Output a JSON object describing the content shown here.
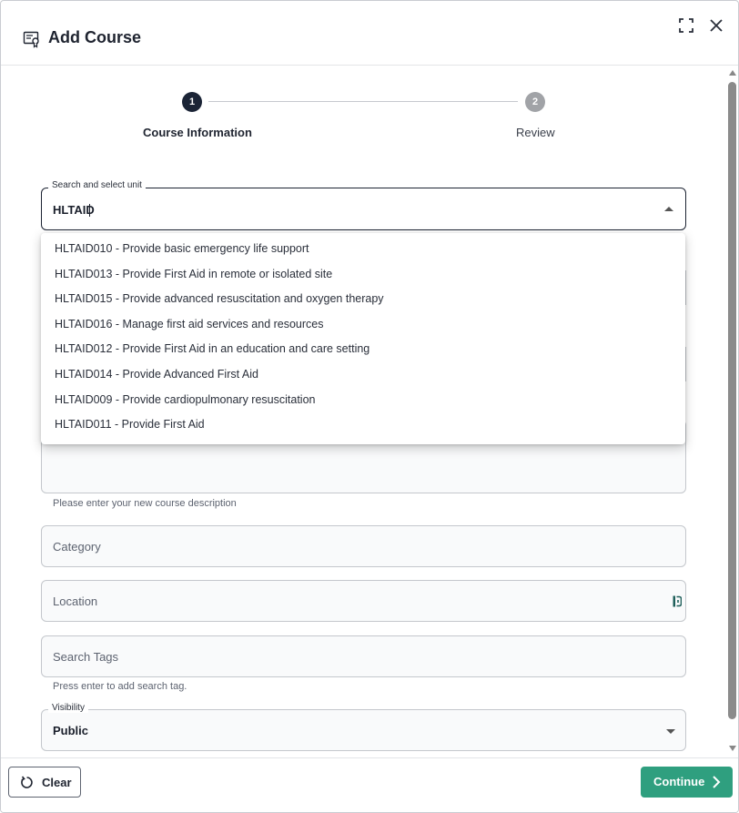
{
  "dialog": {
    "title": "Add Course"
  },
  "stepper": {
    "steps": [
      {
        "number": "1",
        "label": "Course Information"
      },
      {
        "number": "2",
        "label": "Review"
      }
    ]
  },
  "unit_search": {
    "label": "Search and select unit",
    "value": "HLTAID"
  },
  "unit_options": [
    "HLTAID010 - Provide basic emergency life support",
    "HLTAID013 - Provide First Aid in remote or isolated site",
    "HLTAID015 - Provide advanced resuscitation and oxygen therapy",
    "HLTAID016 - Manage first aid services and resources",
    "HLTAID012 - Provide First Aid in an education and care setting",
    "HLTAID014 - Provide Advanced First Aid",
    "HLTAID009 - Provide cardiopulmonary resuscitation",
    "HLTAID011 - Provide First Aid"
  ],
  "description": {
    "helper": "Please enter your new course description"
  },
  "category": {
    "placeholder": "Category"
  },
  "location": {
    "placeholder": "Location"
  },
  "tags": {
    "placeholder": "Search Tags",
    "helper": "Press enter to add search tag."
  },
  "visibility": {
    "label": "Visibility",
    "value": "Public"
  },
  "footer": {
    "clear_label": "Clear",
    "continue_label": "Continue"
  },
  "colors": {
    "primary": "#2f9f7f",
    "active_step": "#1b2436",
    "inactive_step": "#a1a3a7"
  }
}
